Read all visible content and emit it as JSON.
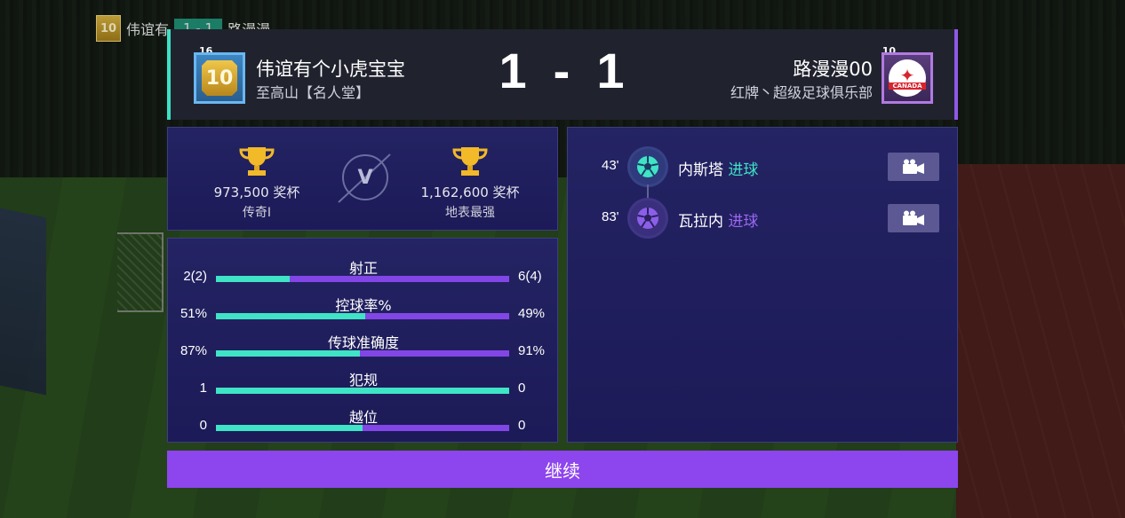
{
  "mini_bar": {
    "tier": "10",
    "home_short": "伟谊有",
    "score": "1 - 1",
    "away_short": "路漫漫"
  },
  "header": {
    "home": {
      "rank": "16",
      "tier": "10",
      "name": "伟谊有个小虎宝宝",
      "club": "至高山【名人堂】"
    },
    "away": {
      "rank": "10",
      "badge_text": "CANADA",
      "name": "路漫漫00",
      "club": "红牌丶超级足球俱乐部"
    },
    "score_home": "1",
    "score_sep": "-",
    "score_away": "1"
  },
  "trophies": {
    "home": {
      "count": "973,500 奖杯",
      "tier_name": "传奇I"
    },
    "vs": "V",
    "away": {
      "count": "1,162,600 奖杯",
      "tier_name": "地表最强"
    }
  },
  "stats": [
    {
      "label": "射正",
      "home": "2(2)",
      "away": "6(4)",
      "home_fraction": 0.25
    },
    {
      "label": "控球率%",
      "home": "51%",
      "away": "49%",
      "home_fraction": 0.51
    },
    {
      "label": "传球准确度",
      "home": "87%",
      "away": "91%",
      "home_fraction": 0.49
    },
    {
      "label": "犯规",
      "home": "1",
      "away": "0",
      "home_fraction": 1.0
    },
    {
      "label": "越位",
      "home": "0",
      "away": "0",
      "home_fraction": 0.5
    }
  ],
  "events": [
    {
      "minute": "43'",
      "player": "内斯塔",
      "type": "进球",
      "side": "home"
    },
    {
      "minute": "83'",
      "player": "瓦拉内",
      "type": "进球",
      "side": "away"
    }
  ],
  "continue_label": "继续",
  "colors": {
    "home_accent": "#3fe3c6",
    "away_accent": "#8346e6",
    "button": "#8d45ee"
  }
}
